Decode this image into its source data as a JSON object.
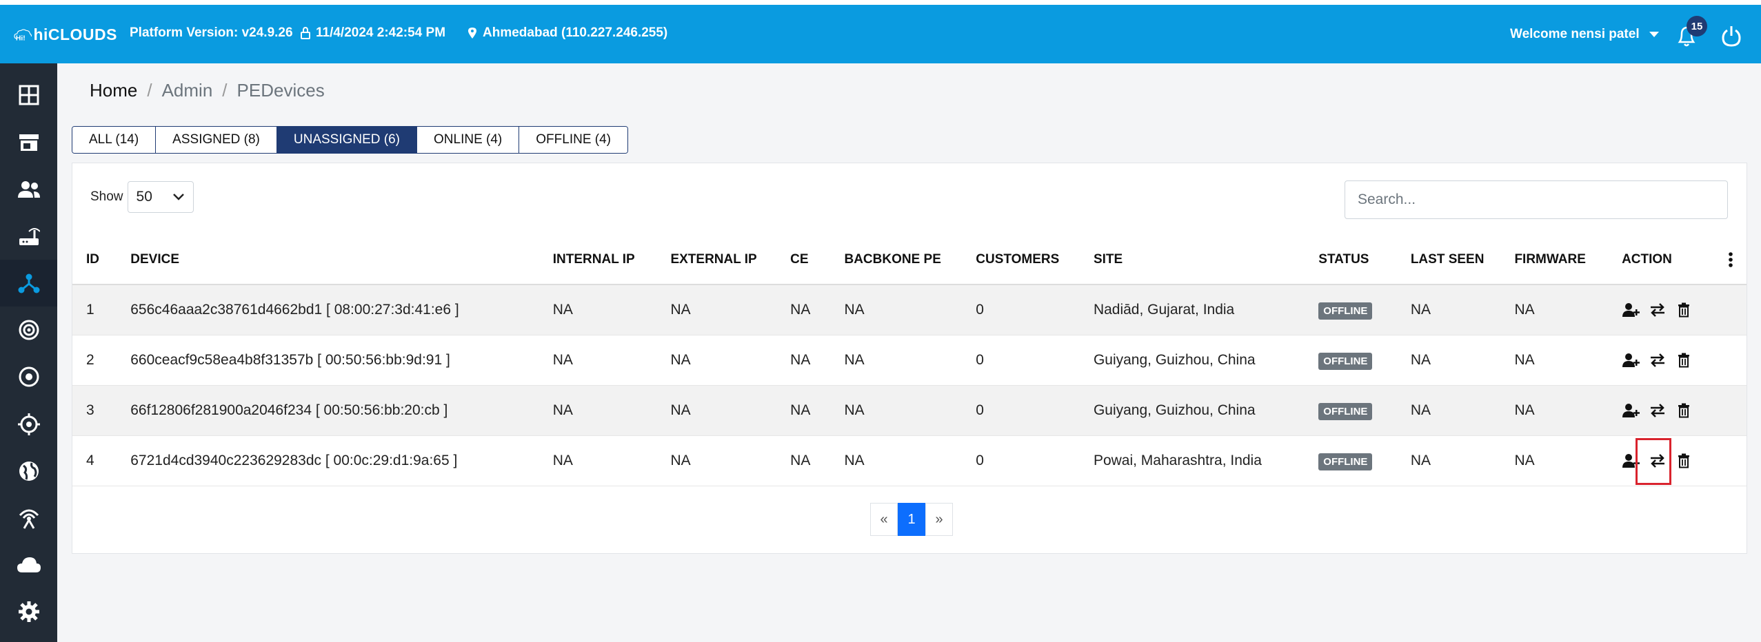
{
  "header": {
    "logo_text": "hiCLOUDS",
    "platform_version": "Platform Version: v24.9.26",
    "datetime": "11/4/2024 2:42:54 PM",
    "location": "Ahmedabad (110.227.246.255)",
    "welcome": "Welcome nensi patel",
    "notification_count": "15"
  },
  "sidebar": {
    "items": [
      {
        "name": "dashboard-icon"
      },
      {
        "name": "store-icon"
      },
      {
        "name": "users-icon"
      },
      {
        "name": "router-icon"
      },
      {
        "name": "network-icon",
        "active": true
      },
      {
        "name": "signal-icon"
      },
      {
        "name": "target-icon"
      },
      {
        "name": "crosshair-icon"
      },
      {
        "name": "globe-icon"
      },
      {
        "name": "antenna-icon"
      },
      {
        "name": "cloud-icon"
      },
      {
        "name": "settings-icon"
      }
    ]
  },
  "breadcrumb": {
    "home": "Home",
    "admin": "Admin",
    "current": "PEDevices",
    "sep": "/"
  },
  "tabs": [
    {
      "label": "ALL (14)"
    },
    {
      "label": "ASSIGNED (8)"
    },
    {
      "label": "UNASSIGNED (6)",
      "active": true
    },
    {
      "label": "ONLINE (4)"
    },
    {
      "label": "OFFLINE (4)"
    }
  ],
  "table_controls": {
    "show_label": "Show",
    "page_size": "50",
    "search_placeholder": "Search..."
  },
  "columns": [
    "ID",
    "DEVICE",
    "INTERNAL IP",
    "EXTERNAL IP",
    "CE",
    "BACBKONE PE",
    "CUSTOMERS",
    "SITE",
    "STATUS",
    "LAST SEEN",
    "FIRMWARE",
    "ACTION"
  ],
  "rows": [
    {
      "id": "1",
      "device": "656c46aaa2c38761d4662bd1 [ 08:00:27:3d:41:e6 ]",
      "internal_ip": "NA",
      "external_ip": "NA",
      "ce": "NA",
      "backbone_pe": "NA",
      "customers": "0",
      "site": "Nadiād, Gujarat, India",
      "status": "OFFLINE",
      "last_seen": "NA",
      "firmware": "NA"
    },
    {
      "id": "2",
      "device": "660ceacf9c58ea4b8f31357b [ 00:50:56:bb:9d:91 ]",
      "internal_ip": "NA",
      "external_ip": "NA",
      "ce": "NA",
      "backbone_pe": "NA",
      "customers": "0",
      "site": "Guiyang, Guizhou, China",
      "status": "OFFLINE",
      "last_seen": "NA",
      "firmware": "NA"
    },
    {
      "id": "3",
      "device": "66f12806f281900a2046f234 [ 00:50:56:bb:20:cb ]",
      "internal_ip": "NA",
      "external_ip": "NA",
      "ce": "NA",
      "backbone_pe": "NA",
      "customers": "0",
      "site": "Guiyang, Guizhou, China",
      "status": "OFFLINE",
      "last_seen": "NA",
      "firmware": "NA"
    },
    {
      "id": "4",
      "device": "6721d4cd3940c223629283dc [ 00:0c:29:d1:9a:65 ]",
      "internal_ip": "NA",
      "external_ip": "NA",
      "ce": "NA",
      "backbone_pe": "NA",
      "customers": "0",
      "site": "Powai, Maharashtra, India",
      "status": "OFFLINE",
      "last_seen": "NA",
      "firmware": "NA"
    }
  ],
  "pagination": {
    "prev": "«",
    "current": "1",
    "next": "»"
  },
  "colors": {
    "header": "#0a9be0",
    "sidebar": "#222b36",
    "tab_active": "#1f3b73",
    "status_offline": "#6c757d",
    "page_active": "#0d6efd",
    "highlight": "#d9232d"
  }
}
